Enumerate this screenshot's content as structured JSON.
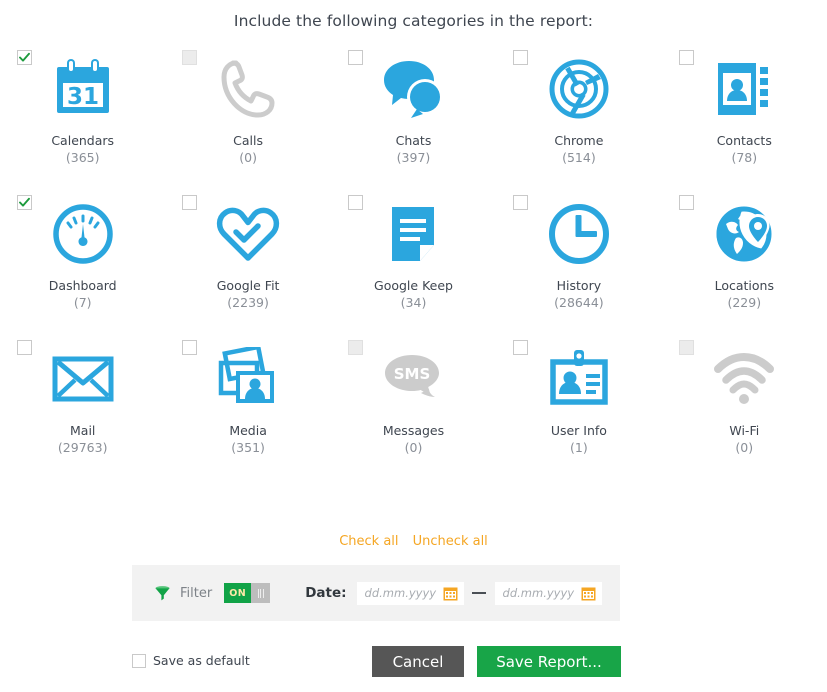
{
  "dialog": {
    "title": "Include the following categories in the report:"
  },
  "categories": [
    {
      "label": "Calendars",
      "count": "(365)",
      "icon": "calendar-icon",
      "checked": true,
      "disabled": false
    },
    {
      "label": "Calls",
      "count": "(0)",
      "icon": "phone-icon",
      "checked": false,
      "disabled": true
    },
    {
      "label": "Chats",
      "count": "(397)",
      "icon": "chat-bubbles-icon",
      "checked": false,
      "disabled": false
    },
    {
      "label": "Chrome",
      "count": "(514)",
      "icon": "chrome-icon",
      "checked": false,
      "disabled": false
    },
    {
      "label": "Contacts",
      "count": "(78)",
      "icon": "contacts-book-icon",
      "checked": false,
      "disabled": false
    },
    {
      "label": "Dashboard",
      "count": "(7)",
      "icon": "gauge-icon",
      "checked": true,
      "disabled": false
    },
    {
      "label": "Google Fit",
      "count": "(2239)",
      "icon": "heart-icon",
      "checked": false,
      "disabled": false
    },
    {
      "label": "Google Keep",
      "count": "(34)",
      "icon": "note-icon",
      "checked": false,
      "disabled": false
    },
    {
      "label": "History",
      "count": "(28644)",
      "icon": "clock-icon",
      "checked": false,
      "disabled": false
    },
    {
      "label": "Locations",
      "count": "(229)",
      "icon": "globe-pin-icon",
      "checked": false,
      "disabled": false
    },
    {
      "label": "Mail",
      "count": "(29763)",
      "icon": "envelope-icon",
      "checked": false,
      "disabled": false
    },
    {
      "label": "Media",
      "count": "(351)",
      "icon": "photos-icon",
      "checked": false,
      "disabled": false
    },
    {
      "label": "Messages",
      "count": "(0)",
      "icon": "sms-bubble-icon",
      "checked": false,
      "disabled": true
    },
    {
      "label": "User Info",
      "count": "(1)",
      "icon": "id-card-icon",
      "checked": false,
      "disabled": false
    },
    {
      "label": "Wi-Fi",
      "count": "(0)",
      "icon": "wifi-icon",
      "checked": false,
      "disabled": true
    }
  ],
  "links": {
    "check_all": "Check all",
    "uncheck_all": "Uncheck all"
  },
  "filter": {
    "label": "Filter",
    "toggle_state": "ON",
    "date_label": "Date:",
    "date_from_value": "",
    "date_from_placeholder": "dd.mm.yyyy",
    "date_to_value": "",
    "date_to_placeholder": "dd.mm.yyyy"
  },
  "footer": {
    "save_as_default": "Save as default",
    "cancel": "Cancel",
    "save_report": "Save Report..."
  },
  "colors": {
    "accent_blue": "#2ba6de",
    "disabled_grey": "#cccccc",
    "link_orange": "#f5a623",
    "green": "#18a548",
    "dark_grey": "#565656"
  }
}
